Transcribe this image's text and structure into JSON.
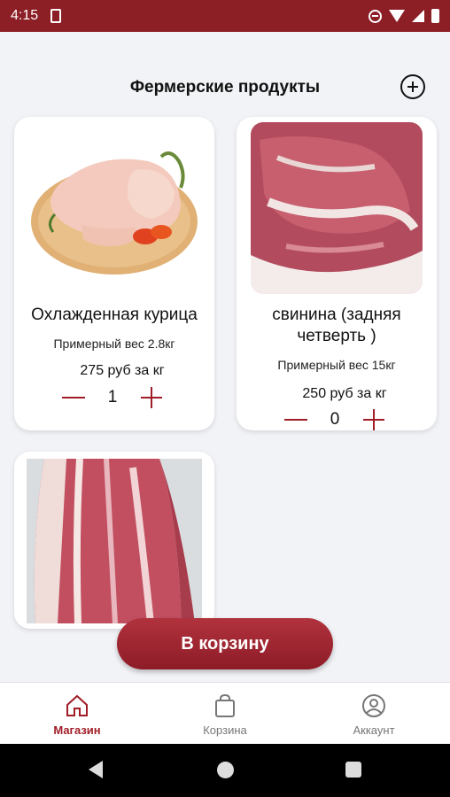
{
  "status_bar": {
    "time": "4:15"
  },
  "header": {
    "title": "Фермерские продукты",
    "add_icon": "plus-circle-icon"
  },
  "products": [
    {
      "name": "Охлажденная курица",
      "weight": "Примерный вес 2.8кг",
      "price": "275 руб за кг",
      "quantity": "1",
      "image": "chicken-image"
    },
    {
      "name": "свинина (задняя четверть )",
      "weight": "Примерный вес 15кг",
      "price": "250 руб за кг",
      "quantity": "0",
      "image": "pork-hindquarter-image"
    },
    {
      "image": "pork-side-image"
    }
  ],
  "cart_button": {
    "label": "В корзину"
  },
  "bottom_nav": {
    "items": [
      {
        "label": "Магазин",
        "icon": "home-icon",
        "active": true
      },
      {
        "label": "Корзина",
        "icon": "shopping-bag-icon",
        "active": false
      },
      {
        "label": "Аккаунт",
        "icon": "account-icon",
        "active": false
      }
    ]
  },
  "colors": {
    "accent": "#a01d27",
    "status_bar": "#8c1e26",
    "background": "#f2f3f7"
  }
}
